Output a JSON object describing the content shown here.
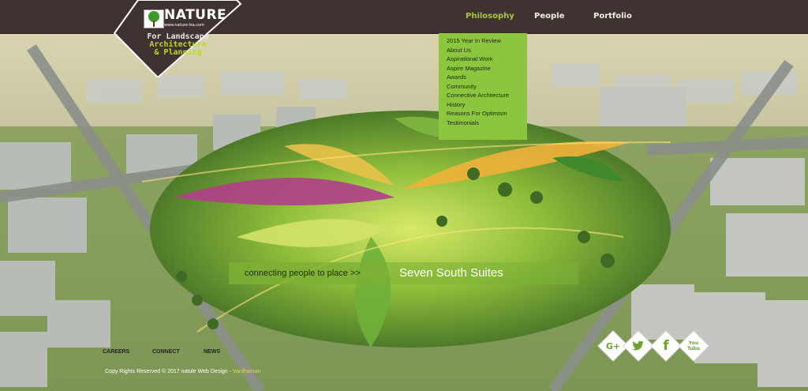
{
  "logo": {
    "title": "NATURE",
    "url": "www.nature-lsa.com",
    "tagline_1": "For Landscape",
    "tagline_2": "Architecture",
    "tagline_3": "& Planning"
  },
  "nav": {
    "items": [
      {
        "label": "Philosophy",
        "active": true
      },
      {
        "label": "People",
        "active": false
      },
      {
        "label": "Portfolio",
        "active": false
      }
    ]
  },
  "dropdown": {
    "items": [
      {
        "label": "2015 Year In Review"
      },
      {
        "label": "About Us"
      },
      {
        "label": "Aspirational Work"
      },
      {
        "label": "Aspire Magazine"
      },
      {
        "label": "Awards"
      },
      {
        "label": "Community"
      },
      {
        "label": "Connective Architecture"
      },
      {
        "label": "History"
      },
      {
        "label": "Reasons For Optimism"
      },
      {
        "label": "Testimonials"
      }
    ]
  },
  "banner": {
    "tag": "connecting people to place  >>",
    "title": "Seven South Suites"
  },
  "footer": {
    "careers": "CAREERS",
    "connect": "CONNECT",
    "news": "NEWS",
    "copyright": "Copy Rights Reserved © 2017 natule Web Design - ",
    "link": "Vardhaman"
  },
  "social": {
    "google": "G+",
    "twitter": "🐦",
    "facebook": "f",
    "youtube_1": "You",
    "youtube_2": "Tube"
  },
  "colors": {
    "topbar": "#3f3331",
    "accent": "#8cc63f",
    "active_nav": "#a6c93a"
  }
}
